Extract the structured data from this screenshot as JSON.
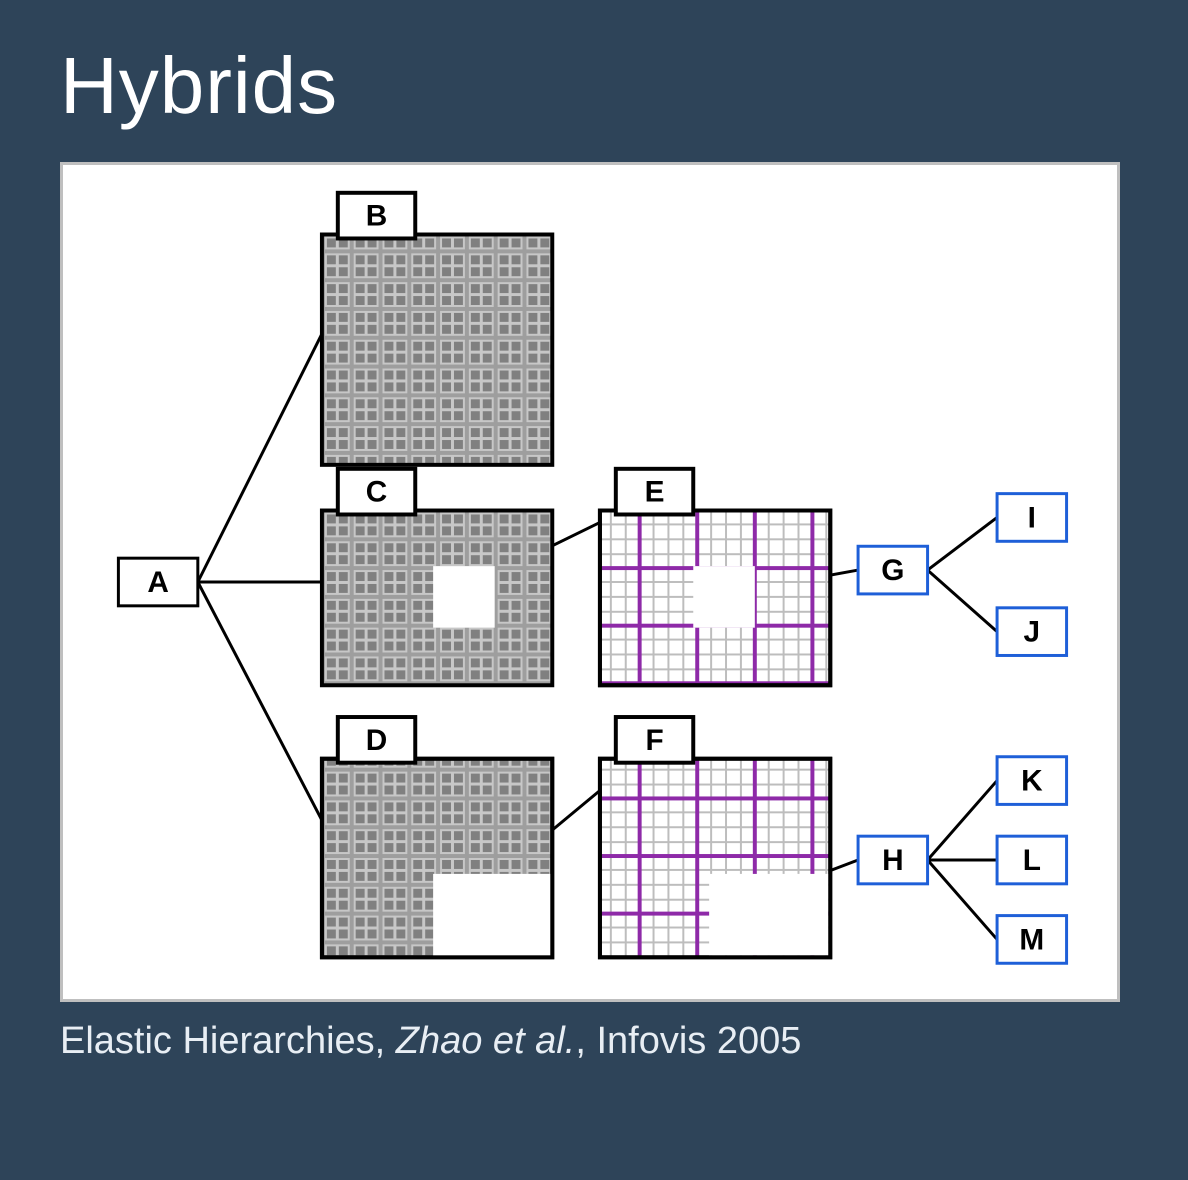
{
  "title": "Hybrids",
  "caption_prefix": "Elastic Hierarchies, ",
  "caption_authors": "Zhao et al.",
  "caption_suffix": ", Infovis 2005",
  "nodes": {
    "A": "A",
    "B": "B",
    "C": "C",
    "D": "D",
    "E": "E",
    "F": "F",
    "G": "G",
    "H": "H",
    "I": "I",
    "J": "J",
    "K": "K",
    "L": "L",
    "M": "M"
  }
}
